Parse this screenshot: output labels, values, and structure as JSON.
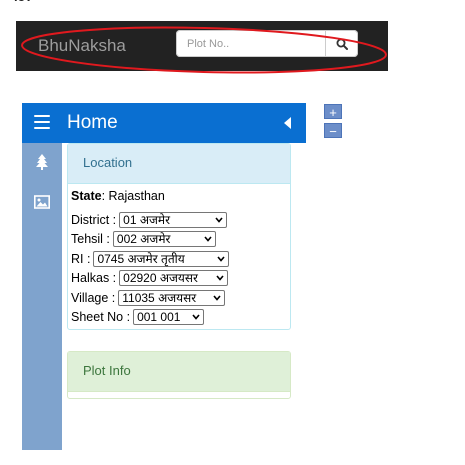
{
  "top_fragment": "ley",
  "navbar": {
    "brand": "BhuNaksha",
    "search_placeholder": "Plot No..",
    "search_icon": "search-icon",
    "background": "#222222",
    "annotation_color": "#e0191e"
  },
  "map_controls": {
    "zoom_in": "+",
    "zoom_out": "−"
  },
  "panel": {
    "title": "Home",
    "menu_icon": "hamburger-icon",
    "collapse_icon": "caret-left-icon",
    "header_color": "#0a6fd1"
  },
  "sidebar": {
    "icons": [
      "tree-icon",
      "image-icon"
    ],
    "color": "#7fa3cd"
  },
  "location": {
    "title": "Location",
    "state_label": "State",
    "state_value": ": Rajasthan",
    "fields": [
      {
        "label": "District :",
        "value": "01 अजमेर"
      },
      {
        "label": "Tehsil :",
        "value": "002 अजमेर"
      },
      {
        "label": "RI :",
        "value": "0745 अजमेर तृतीय"
      },
      {
        "label": "Halkas :",
        "value": "02920 अजयसर"
      },
      {
        "label": "Village :",
        "value": "11035 अजयसर"
      },
      {
        "label": "Sheet No :",
        "value": "001 001"
      }
    ]
  },
  "plot_info": {
    "title": "Plot Info"
  }
}
